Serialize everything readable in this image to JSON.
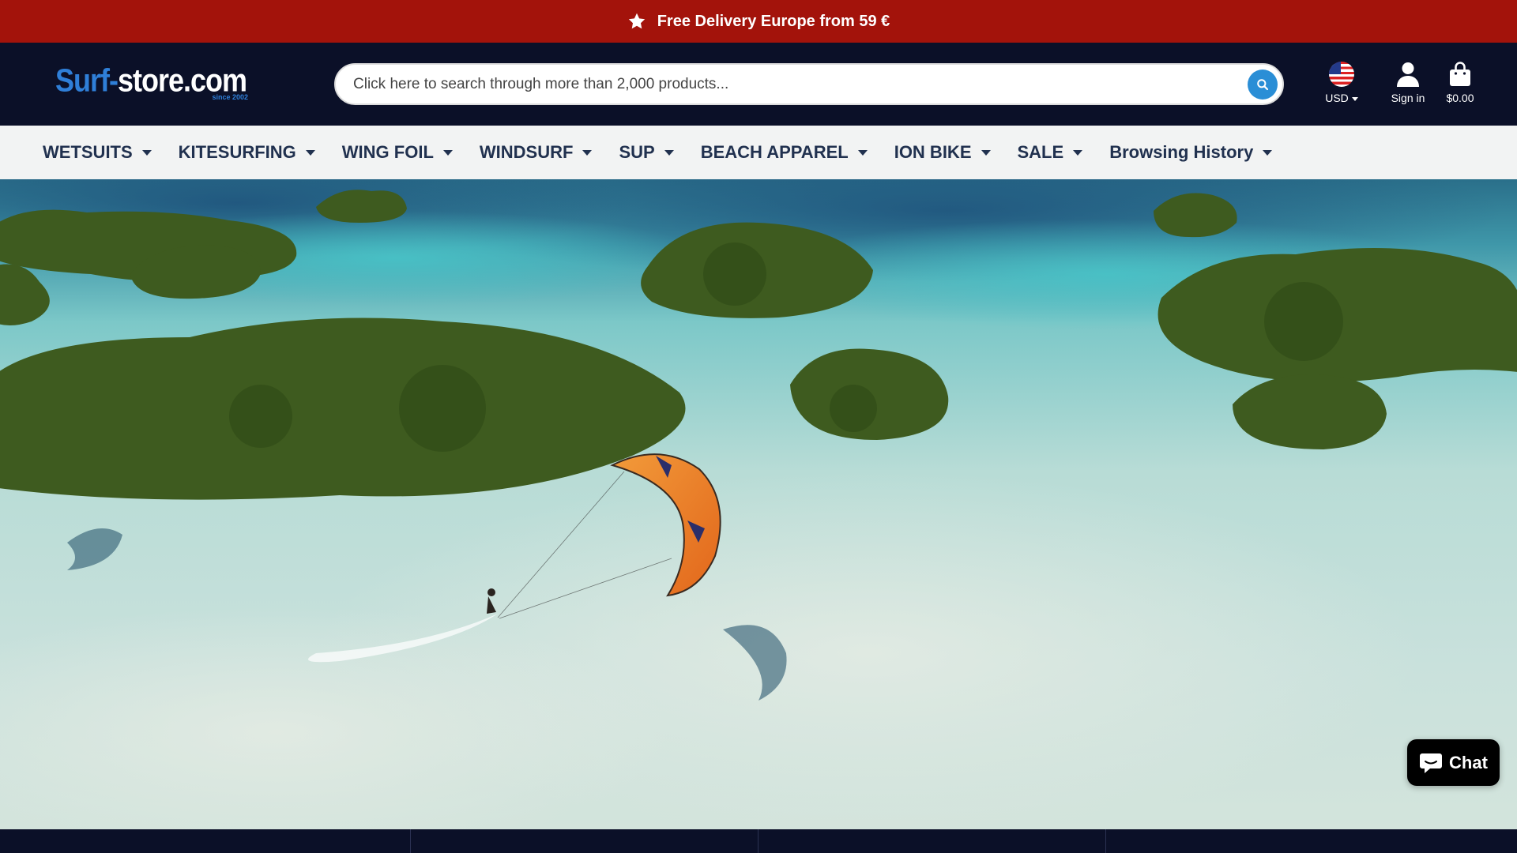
{
  "announcement": {
    "text": "Free Delivery Europe from 59 €",
    "icon": "star-icon"
  },
  "header": {
    "logo_main_part1": "Surf-",
    "logo_main_part2": "store.com",
    "logo_since": "since 2002",
    "search_placeholder": "Click here to search through more than 2,000 products...",
    "currency_label": "USD",
    "signin_label": "Sign in",
    "cart_label": "$0.00"
  },
  "nav": {
    "items": [
      {
        "label": "WETSUITS"
      },
      {
        "label": "KITESURFING"
      },
      {
        "label": "WING FOIL"
      },
      {
        "label": "WINDSURF"
      },
      {
        "label": "SUP"
      },
      {
        "label": "BEACH APPAREL"
      },
      {
        "label": "ION BIKE"
      },
      {
        "label": "SALE"
      },
      {
        "label": "Browsing History"
      }
    ]
  },
  "chat": {
    "label": "Chat"
  },
  "colors": {
    "announcement_bg": "#a3130b",
    "header_bg": "#0b1028",
    "nav_bg": "#f2f3f3",
    "nav_text": "#21314f",
    "accent": "#2a8ed6"
  }
}
